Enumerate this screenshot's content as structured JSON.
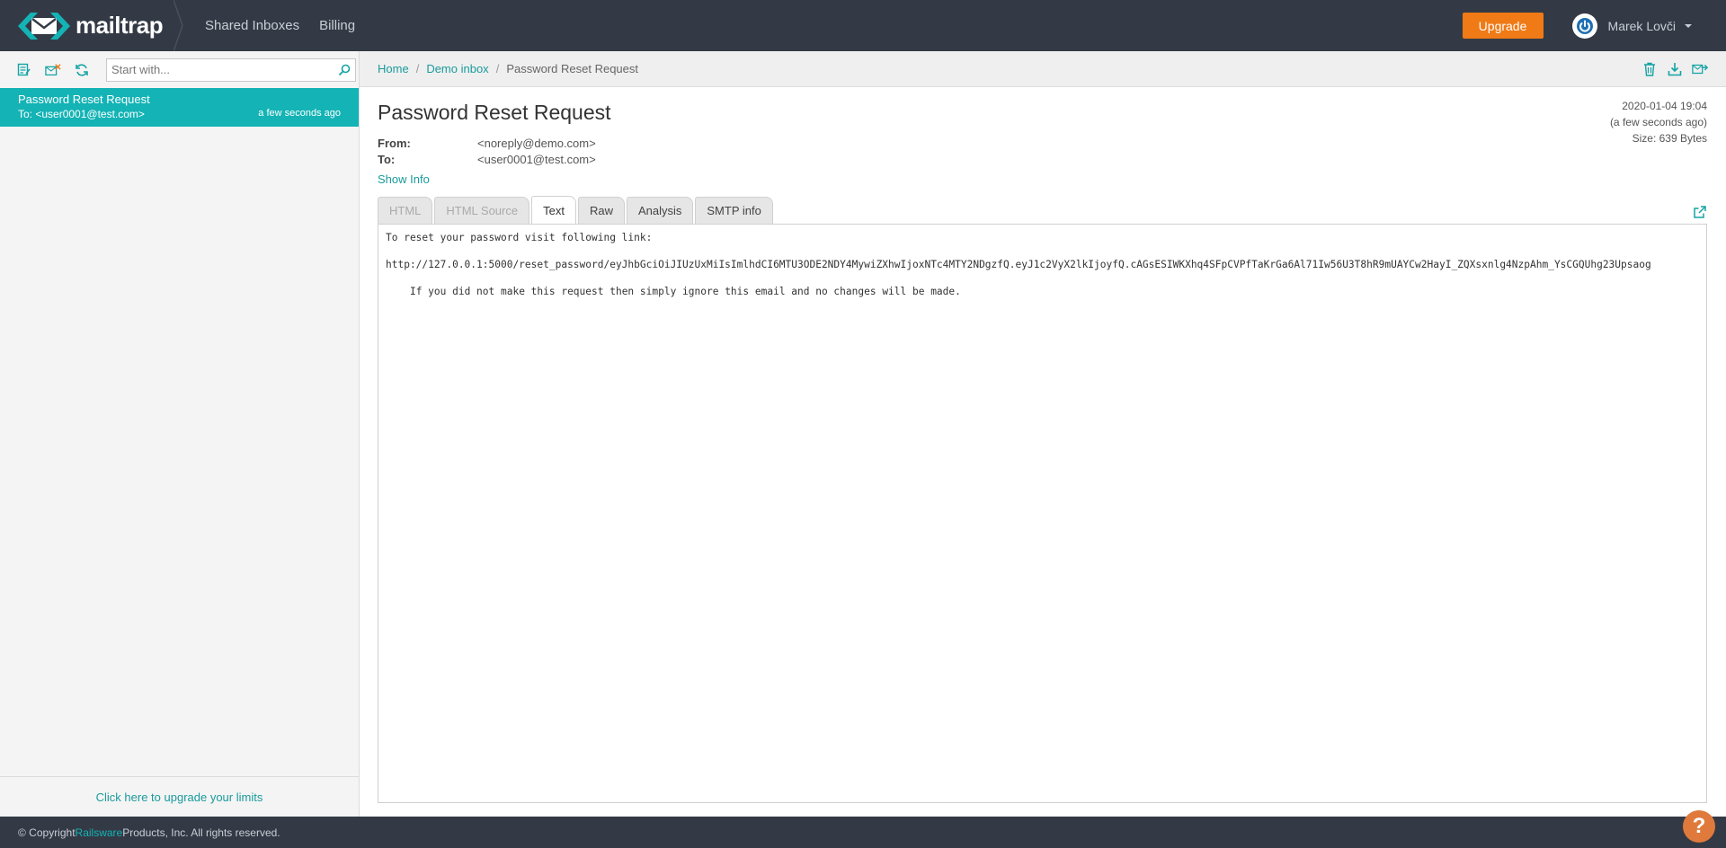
{
  "brand": {
    "name": "mailtrap"
  },
  "nav": {
    "shared_inboxes": "Shared Inboxes",
    "billing": "Billing"
  },
  "header": {
    "upgrade_label": "Upgrade",
    "user_name": "Marek Lovči"
  },
  "sidebar": {
    "search_placeholder": "Start with...",
    "messages": [
      {
        "subject": "Password Reset Request",
        "to": "To: <user0001@test.com>",
        "time": "a few seconds ago"
      }
    ],
    "upgrade_link": "Click here to upgrade your limits"
  },
  "breadcrumb": {
    "home": "Home",
    "inbox": "Demo inbox",
    "current": "Password Reset Request"
  },
  "message": {
    "subject": "Password Reset Request",
    "date": "2020-01-04 19:04",
    "relative": "(a few seconds ago)",
    "size": "Size: 639 Bytes",
    "from_label": "From:",
    "from_value": "<noreply@demo.com>",
    "to_label": "To:",
    "to_value": "<user0001@test.com>",
    "show_info": "Show Info"
  },
  "tabs": [
    {
      "label": "HTML",
      "state": "disabled"
    },
    {
      "label": "HTML Source",
      "state": "disabled"
    },
    {
      "label": "Text",
      "state": "active"
    },
    {
      "label": "Raw",
      "state": "normal"
    },
    {
      "label": "Analysis",
      "state": "normal"
    },
    {
      "label": "SMTP info",
      "state": "normal"
    }
  ],
  "body_text": "To reset your password visit following link:\n\nhttp://127.0.0.1:5000/reset_password/eyJhbGciOiJIUzUxMiIsImlhdCI6MTU3ODE2NDY4MywiZXhwIjoxNTc4MTY2NDgzfQ.eyJ1c2VyX2lkIjoyfQ.cAGsESIWKXhq4SFpCVPfTaKrGa6Al71Iw56U3T8hR9mUAYCw2HayI_ZQXsxnlg4NzpAhm_YsCGQUhg23Upsaog\n\n    If you did not make this request then simply ignore this email and no changes will be made.",
  "footer": {
    "prefix": "© Copyright ",
    "company": "Railsware",
    "suffix": " Products, Inc. All rights reserved."
  },
  "colors": {
    "topbar": "#333a45",
    "accent": "#14b3b5",
    "upgrade": "#f07a16"
  }
}
